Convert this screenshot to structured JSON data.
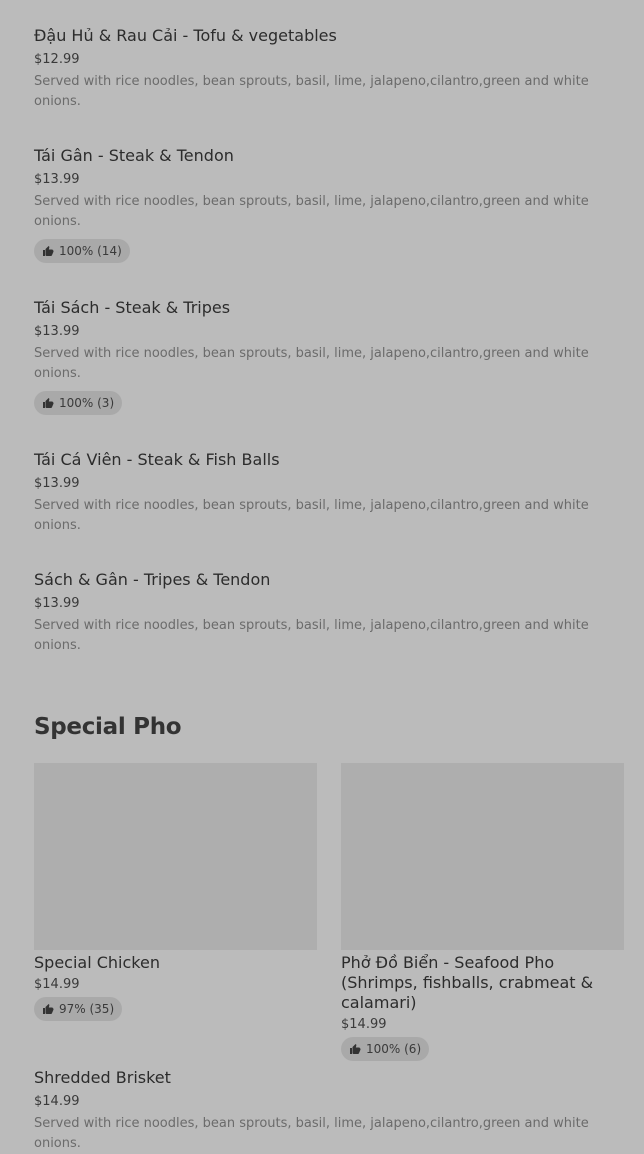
{
  "items": [
    {
      "name": "Đậu Hủ & Rau Cải - Tofu & vegetables",
      "price": "$12.99",
      "desc": "Served with rice noodles, bean sprouts, basil, lime, jalapeno,cilantro,green and white onions."
    },
    {
      "name": "Tái Gân - Steak & Tendon",
      "price": "$13.99",
      "desc": "Served with rice noodles, bean sprouts, basil, lime, jalapeno,cilantro,green and white onions.",
      "rating": "100% (14)"
    },
    {
      "name": "Tái Sách - Steak & Tripes",
      "price": "$13.99",
      "desc": "Served with rice noodles, bean sprouts, basil, lime, jalapeno,cilantro,green and white onions.",
      "rating": "100% (3)"
    },
    {
      "name": "Tái Cá Viên - Steak & Fish Balls",
      "price": "$13.99",
      "desc": "Served with rice noodles, bean sprouts, basil, lime, jalapeno,cilantro,green and white onions."
    },
    {
      "name": "Sách & Gân - Tripes & Tendon",
      "price": "$13.99",
      "desc": "Served with rice noodles, bean sprouts, basil, lime, jalapeno,cilantro,green and white onions."
    }
  ],
  "special_section": {
    "title": "Special Pho",
    "cards": [
      {
        "name": "Special Chicken",
        "price": "$14.99",
        "rating": "97% (35)"
      },
      {
        "name": "Phở Đồ Biển - Seafood Pho (Shrimps, fishballs, crabmeat & calamari)",
        "price": "$14.99",
        "rating": "100% (6)"
      }
    ],
    "next_item": {
      "name": "Shredded Brisket",
      "price": "$14.99",
      "desc": "Served with rice noodles, bean sprouts, basil, lime, jalapeno,cilantro,green and white onions."
    }
  },
  "icons": {
    "thumbs_up": "thumbs-up-icon"
  }
}
